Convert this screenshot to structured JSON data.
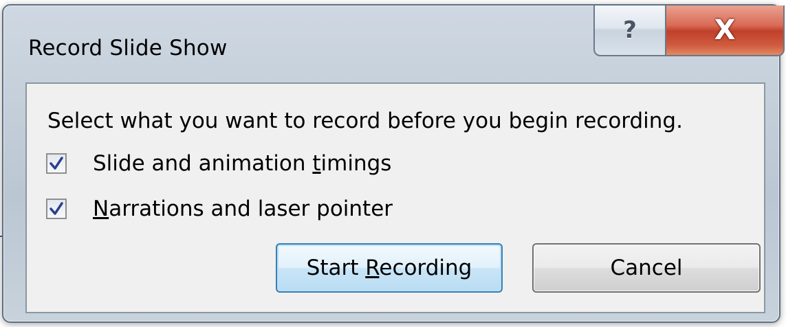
{
  "dialog": {
    "title": "Record Slide Show",
    "help_glyph": "?",
    "close_glyph": "X",
    "instruction": "Select what you want to record before you begin recording.",
    "options": [
      {
        "pre": "Slide and animation ",
        "mnemonic": "t",
        "post": "imings",
        "checked": true
      },
      {
        "pre": "",
        "mnemonic": "N",
        "post": "arrations and laser pointer",
        "checked": true
      }
    ],
    "start_button": {
      "pre": "Start ",
      "mnemonic": "R",
      "post": "ecording"
    },
    "cancel_button": {
      "label": "Cancel"
    }
  },
  "icons": {
    "help": "question-mark-icon",
    "close": "close-x-icon",
    "check": "checkmark-icon"
  },
  "colors": {
    "close_red": "#c0402a",
    "default_button_blue": "#3c7fb1",
    "checkmark": "#2a3f8f"
  }
}
